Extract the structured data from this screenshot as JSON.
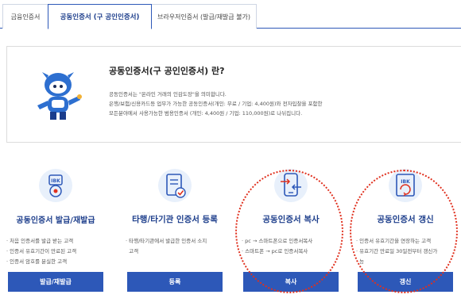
{
  "tabs": [
    {
      "label": "금융인증서"
    },
    {
      "label": "공동인증서 (구 공인인증서)"
    },
    {
      "label": "브라우저인증서 (발급/재발급 불가)"
    }
  ],
  "info": {
    "title": "공동인증서(구 공인인증서) 란?",
    "lines": [
      "공동인증서는 \"온라인 거래의 인감도장\"을 의미합니다.",
      "은행/보험/신용카드등 업무가 가능한 공동인증서(개인: 무료 / 기업: 4,400원)와 전자입찰을 포함한",
      "모든분야에서 사용가능한 범용인증서 (개인: 4,400원 / 기업: 110,000원)로 나뉘집니다."
    ]
  },
  "cards": [
    {
      "title": "공동인증서 발급/재발급",
      "bullets": [
        "처음 인증서를 발급 받는 고객",
        "인증서 유효기간이 만료된 고객",
        "인증서 암호를 분실한 고객"
      ],
      "button": "발급/재발급",
      "icon": "ibk-certificate-icon",
      "icon_text": "IBK"
    },
    {
      "title": "타행/타기관 인증서 등록",
      "bullets": [
        "타행/타기관에서 발급한 인증서 소지",
        "고객"
      ],
      "button": "등록",
      "icon": "document-check-icon"
    },
    {
      "title": "공동인증서 복사",
      "bullets": [
        "pc → 스마트폰으로 인증서복사",
        "스마트폰 → pc로 인증서복사"
      ],
      "button": "복사",
      "icon": "phone-transfer-icon"
    },
    {
      "title": "공동인증서 갱신",
      "bullets": [
        "인증서 유효기간을 연장하는 고객",
        "유효기간 만료일 30일전부터 갱신가",
        "능"
      ],
      "button": "갱신",
      "icon": "ibk-renew-icon",
      "icon_text": "IBK"
    }
  ],
  "colors": {
    "accent": "#2d58b8",
    "title": "#1e3f8c",
    "highlight": "#e0301e"
  }
}
